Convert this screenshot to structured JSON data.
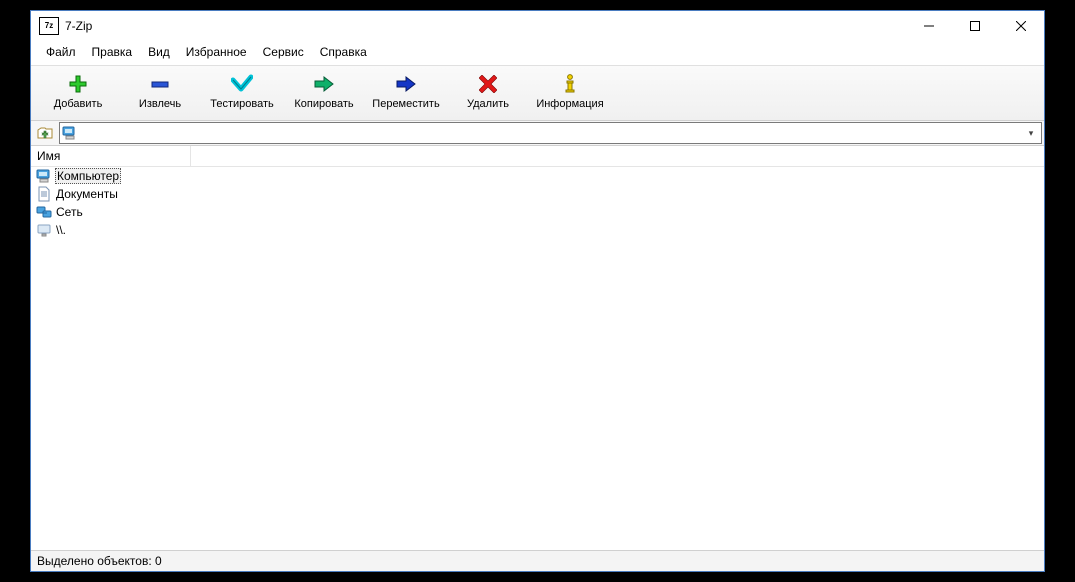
{
  "window": {
    "app_icon_text": "7z",
    "title": "7-Zip"
  },
  "menu": {
    "items": [
      "Файл",
      "Правка",
      "Вид",
      "Избранное",
      "Сервис",
      "Справка"
    ]
  },
  "toolbar": {
    "add": "Добавить",
    "extract": "Извлечь",
    "test": "Тестировать",
    "copy": "Копировать",
    "move": "Переместить",
    "delete": "Удалить",
    "info": "Информация"
  },
  "address": {
    "path_value": ""
  },
  "columns": {
    "name": "Имя"
  },
  "items": [
    {
      "label": "Компьютер",
      "icon": "computer",
      "selected": true
    },
    {
      "label": "Документы",
      "icon": "document",
      "selected": false
    },
    {
      "label": "Сеть",
      "icon": "network",
      "selected": false
    },
    {
      "label": "\\\\.",
      "icon": "monitor",
      "selected": false
    }
  ],
  "status": {
    "selected_text": "Выделено объектов: 0"
  }
}
